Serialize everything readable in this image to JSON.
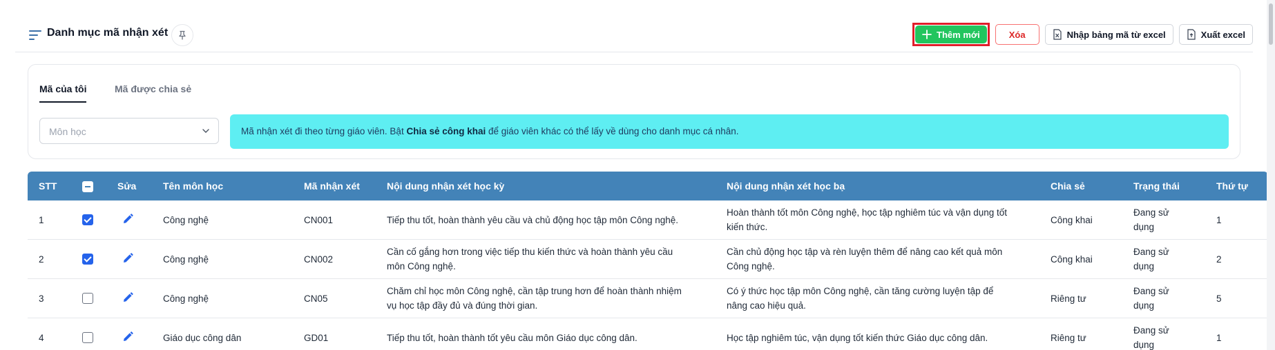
{
  "header": {
    "title": "Danh mục mã nhận xét",
    "icons": {
      "menu": "filter-lines-icon",
      "pin": "pin-icon"
    }
  },
  "actions": {
    "add_label": "Thêm mới",
    "delete_label": "Xóa",
    "import_label": "Nhập bảng mã từ excel",
    "export_label": "Xuất excel"
  },
  "tabs": [
    {
      "label": "Mã của tôi",
      "active": true
    },
    {
      "label": "Mã được chia sẻ",
      "active": false
    }
  ],
  "filter": {
    "subject_placeholder": "Môn học"
  },
  "info": {
    "prefix": "Mã nhận xét đi theo từng giáo viên. Bật ",
    "highlight": "Chia sẻ công khai",
    "suffix": " để giáo viên khác có thể lấy về dùng cho danh mục cá nhân."
  },
  "table": {
    "columns": [
      "STT",
      "Sửa",
      "Tên môn học",
      "Mã nhận xét",
      "Nội dung nhận xét học kỳ",
      "Nội dung nhận xét học bạ",
      "Chia sẻ",
      "Trạng thái",
      "Thứ tự"
    ],
    "rows": [
      {
        "stt": "1",
        "checked": true,
        "subject": "Công nghệ",
        "code": "CN001",
        "semester_line1": "Tiếp thu tốt, hoàn thành yêu cầu và chủ động học tập môn Công nghệ.",
        "semester_line2": "",
        "record_line1": "Hoàn thành tốt môn Công nghệ, học tập nghiêm túc và vận dụng tốt",
        "record_line2": "kiến thức.",
        "share": "Công khai",
        "status_line1": "Đang sử",
        "status_line2": "dụng",
        "order": "1"
      },
      {
        "stt": "2",
        "checked": true,
        "subject": "Công nghệ",
        "code": "CN002",
        "semester_line1": "Cần cố gắng hơn trong việc tiếp thu kiến thức và hoàn thành yêu cầu",
        "semester_line2": "môn Công nghệ.",
        "record_line1": "Cần chủ động học tập và rèn luyện thêm để nâng cao kết quả môn",
        "record_line2": "Công nghệ.",
        "share": "Công khai",
        "status_line1": "Đang sử",
        "status_line2": "dụng",
        "order": "2"
      },
      {
        "stt": "3",
        "checked": false,
        "subject": "Công nghệ",
        "code": "CN05",
        "semester_line1": "Chăm chỉ học môn Công nghệ, cần tập trung hơn để hoàn thành nhiệm",
        "semester_line2": "vụ học tập đầy đủ và đúng thời gian.",
        "record_line1": "Có ý thức học tập môn Công nghệ, cần tăng cường luyện tập để",
        "record_line2": "nâng cao hiệu quả.",
        "share": "Riêng tư",
        "status_line1": "Đang sử",
        "status_line2": "dụng",
        "order": "5"
      },
      {
        "stt": "4",
        "checked": false,
        "subject": "Giáo dục công dân",
        "code": "GD01",
        "semester_line1": "Tiếp thu tốt, hoàn thành tốt yêu cầu môn Giáo dục công dân.",
        "semester_line2": "",
        "record_line1": "Học tập nghiêm túc, vận dụng tốt kiến thức Giáo dục công dân.",
        "record_line2": "",
        "share": "Riêng tư",
        "status_line1": "Đang sử",
        "status_line2": "dụng",
        "order": "1"
      }
    ]
  },
  "colors": {
    "header_bg": "#4383b8",
    "add_button": "#22c55e",
    "delete_text": "#dc2626",
    "info_bg": "#5eeef2",
    "check_blue": "#2563eb",
    "highlight_border": "#e11d2a"
  }
}
